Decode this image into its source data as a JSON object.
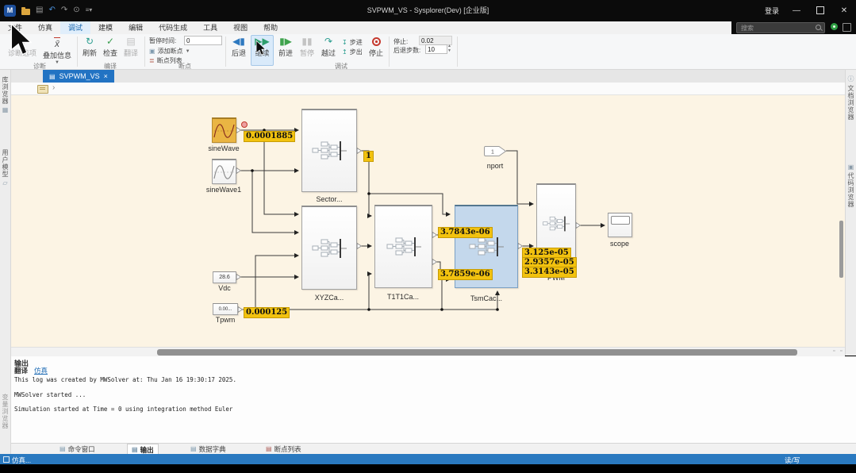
{
  "titlebar": {
    "title": "SVPWM_VS - Sysplorer(Dev) [企业版]",
    "login": "登录"
  },
  "search": {
    "placeholder": "搜索"
  },
  "menu": {
    "items": [
      "文件",
      "仿真",
      "调试",
      "建模",
      "编辑",
      "代码生成",
      "工具",
      "视图",
      "帮助"
    ]
  },
  "ribbon": {
    "diagnosis": {
      "group": "诊断",
      "options": "诊断选项",
      "overlay": "叠加信息"
    },
    "compile": {
      "group": "编译",
      "refresh": "刷新",
      "check": "检查",
      "translate": "翻译"
    },
    "breakpoints": {
      "group": "断点",
      "pause_time_label": "暂停时间:",
      "pause_time_value": "0",
      "add_breakpoint": "添加断点",
      "breakpoint_list": "断点列表"
    },
    "debug": {
      "group": "调试",
      "back": "后退",
      "resume": "继续",
      "forward": "前进",
      "pause": "暂停",
      "step_over": "越过",
      "step_in": "步进",
      "step_out": "步出",
      "stop": "停止",
      "stop_time_label": "停止:",
      "stop_time_value": "0.02",
      "back_steps_label": "后退步数:",
      "back_steps_value": "10"
    }
  },
  "side_tabs": {
    "library": "库浏览器",
    "user_models": "用户模型",
    "variables": "变量浏览器",
    "documents": "文档浏览器",
    "code": "代码浏览器"
  },
  "doc_tab": {
    "title": "SVPWM_VS"
  },
  "diagram": {
    "blocks": {
      "sinewave": {
        "label": "sineWave"
      },
      "sinewave1": {
        "label": "sineWave1"
      },
      "sector": {
        "label": "Sector..."
      },
      "xyz": {
        "label": "XYZCa..."
      },
      "t1t1": {
        "label": "T1T1Ca..."
      },
      "tsm": {
        "label": "TsmCac..."
      },
      "pwm": {
        "label": "PWM"
      },
      "nport": {
        "label": "nport",
        "value": "1"
      },
      "scope": {
        "label": "scope"
      },
      "vdc": {
        "label": "Vdc",
        "value": "28.6"
      },
      "tpwm": {
        "label": "Tpwm",
        "value": "0.00..."
      }
    },
    "probe_values": {
      "sinewave_out": "0.0001885",
      "sector_out": "1",
      "tpwm_out": "0.000125",
      "t1t1_out_upper": "3.7843e-06",
      "t1t1_out_lower": "3.7859e-06",
      "pwm_in": [
        "3.125e-05",
        "2.9357e-05",
        "3.3143e-05"
      ]
    }
  },
  "output_panel": {
    "title": "输出",
    "filters": [
      "翻译",
      "仿真"
    ],
    "log_lines": [
      "This log was created by MWSolver at: Thu Jan 16 19:30:17 2025.",
      "",
      "MWSolver started ...",
      "",
      "Simulation started at Time = 0 using integration method Euler"
    ]
  },
  "bottom_tabs": {
    "items": [
      "命令窗口",
      "输出",
      "数据字典",
      "断点列表"
    ]
  },
  "statusbar": {
    "left": "仿真...",
    "right": "读/写"
  }
}
